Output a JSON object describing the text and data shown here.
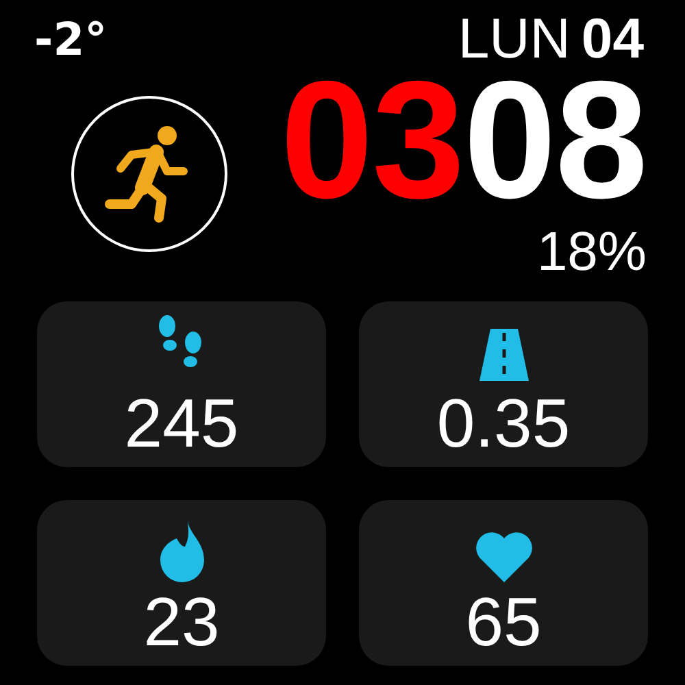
{
  "temperature": "-2°",
  "date": {
    "weekday": "LUN",
    "day": "04"
  },
  "time": {
    "hours": "03",
    "minutes": "08"
  },
  "battery": "18%",
  "tiles": [
    {
      "kind": "steps",
      "value": "245"
    },
    {
      "kind": "distance",
      "value": "0.35"
    },
    {
      "kind": "calories",
      "value": "23"
    },
    {
      "kind": "heart",
      "value": "65"
    }
  ]
}
